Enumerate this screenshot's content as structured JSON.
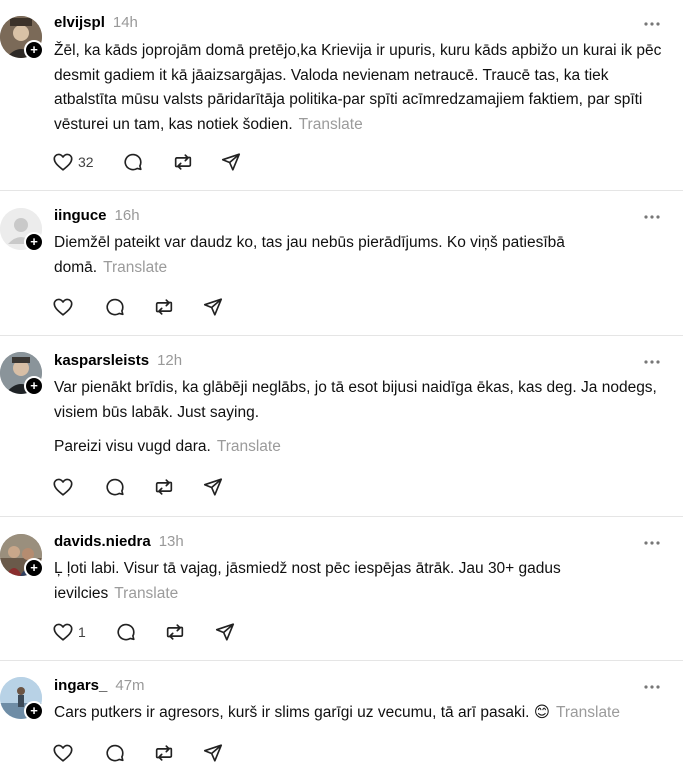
{
  "icons": {
    "like": "heart-icon",
    "reply": "comment-icon",
    "repost": "repost-icon",
    "share": "send-icon",
    "more": "more-icon",
    "follow": "plus-icon"
  },
  "translate_label": "Translate",
  "posts": [
    {
      "username": "elvijspl",
      "time": "14h",
      "paragraphs": [
        "Žēl, ka kāds joprojām domā pretējo,ka Krievija ir upuris, kuru kāds apbižo un kurai ik pēc desmit gadiem it kā jāaizsargājas. Valoda nevienam netraucē. Traucē tas, ka tiek atbalstīta mūsu valsts pāridarītāja politika-par spīti acīmredzamajiem faktiem, par spīti vēsturei un tam, kas notiek šodien."
      ],
      "likes": "32"
    },
    {
      "username": "iinguce",
      "time": "16h",
      "paragraphs": [
        "Diemžēl pateikt var daudz ko, tas jau nebūs pierādījums. Ko viņš patiesībā domā."
      ],
      "likes": ""
    },
    {
      "username": "kasparsleists",
      "time": "12h",
      "paragraphs": [
        "Var pienākt brīdis, ka glābēji neglābs, jo tā esot bijusi naidīga ēkas, kas deg. Ja nodegs, visiem būs labāk. Just saying.",
        "Pareizi visu vugd dara."
      ],
      "likes": ""
    },
    {
      "username": "davids.niedra",
      "time": "13h",
      "paragraphs": [
        "Ļ ļoti labi. Visur tā vajag, jāsmiedž nost pēc iespējas ātrāk. Jau 30+ gadus ievilcies"
      ],
      "likes": "1"
    },
    {
      "username": "ingars_",
      "time": "47m",
      "paragraphs": [
        "Cars putkers ir agresors, kurš ir slims garīgi uz vecumu, tā arī pasaki. 😊"
      ],
      "likes": ""
    }
  ]
}
